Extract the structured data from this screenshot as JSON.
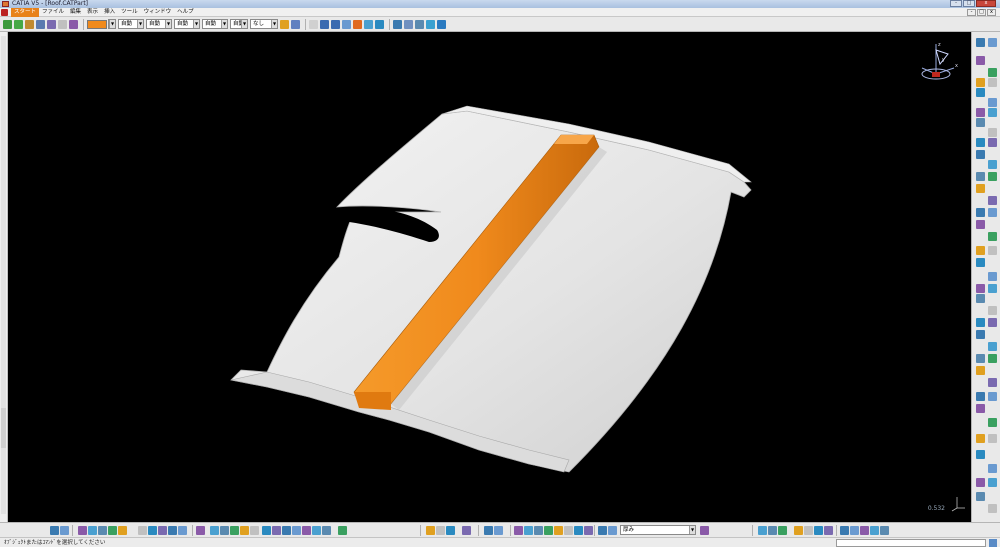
{
  "window": {
    "title": "CATIA V5 - [Roof.CATPart]",
    "controls": {
      "minimize": "-",
      "maximize": "□",
      "close": "x"
    }
  },
  "menu": {
    "items": [
      "スタート",
      "ファイル",
      "編集",
      "表示",
      "挿入",
      "ツール",
      "ウィンドウ",
      "ヘルプ"
    ],
    "active_index": 0
  },
  "toolbar": {
    "color_value": "#f08a1c",
    "dropdowns": [
      {
        "value": "自動"
      },
      {
        "value": "自動"
      },
      {
        "value": "自動"
      },
      {
        "value": "自動"
      },
      {
        "value": "自動"
      },
      {
        "value": "なし"
      }
    ]
  },
  "viewport": {
    "zoom_readout": "0.532",
    "compass_labels": {
      "z": "z",
      "x": "x",
      "y": "y"
    },
    "surface_color": "#e6e6e6",
    "feature_color": "#f08a1c"
  },
  "bottom": {
    "dropdown_value": "厚み"
  },
  "status": {
    "message": "ｵﾌﾞｼﾞｪｸﾄまたはｺﾏﾝﾄﾞを選択してください"
  }
}
